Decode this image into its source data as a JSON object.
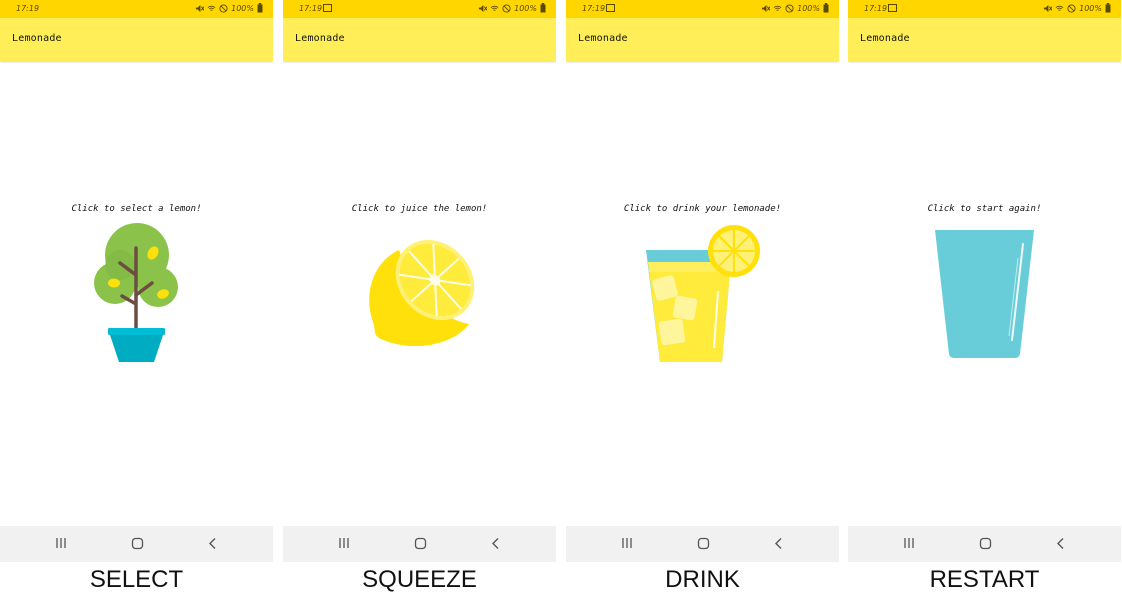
{
  "app": {
    "title": "Lemonade"
  },
  "status": {
    "time": "17:19",
    "battery": "100%"
  },
  "screens": [
    {
      "instruction": "Click to select a lemon!",
      "caption": "SELECT",
      "illustration": "lemon-tree"
    },
    {
      "instruction": "Click to juice the lemon!",
      "caption": "SQUEEZE",
      "illustration": "lemon-half"
    },
    {
      "instruction": "Click to drink your lemonade!",
      "caption": "DRINK",
      "illustration": "lemonade-glass"
    },
    {
      "instruction": "Click to start again!",
      "caption": "RESTART",
      "illustration": "empty-glass"
    }
  ],
  "colors": {
    "status_bar": "#FFD600",
    "app_bar": "#FFEE58",
    "nav_bar": "#F1F1F1",
    "lemon": "#FFE00A",
    "glass": "#68CDD9"
  },
  "icons": [
    "status-mute-icon",
    "wifi-icon",
    "dnd-icon",
    "battery-icon",
    "recents-icon",
    "home-icon",
    "back-icon"
  ]
}
